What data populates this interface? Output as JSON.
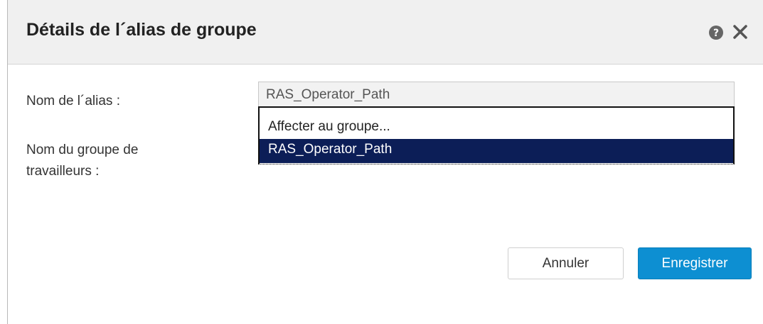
{
  "dialog": {
    "title": "Détails de l´alias de groupe",
    "help_icon": "help-icon",
    "close_icon": "close-icon"
  },
  "form": {
    "alias_label": "Nom de l´alias :",
    "alias_value": "RAS_Operator_Path",
    "worker_group_label_line1": "Nom du groupe de",
    "worker_group_label_line2": "travailleurs :",
    "dropdown_options": [
      "Affecter au groupe...",
      "RAS_Operator_Path"
    ],
    "dropdown_selected": "RAS_Operator_Path"
  },
  "buttons": {
    "cancel_label": "Annuler",
    "save_label": "Enregistrer"
  },
  "colors": {
    "header_bg": "#f0f0f0",
    "selected_option_bg": "#0c1e57",
    "primary_button": "#0d8fd2"
  }
}
